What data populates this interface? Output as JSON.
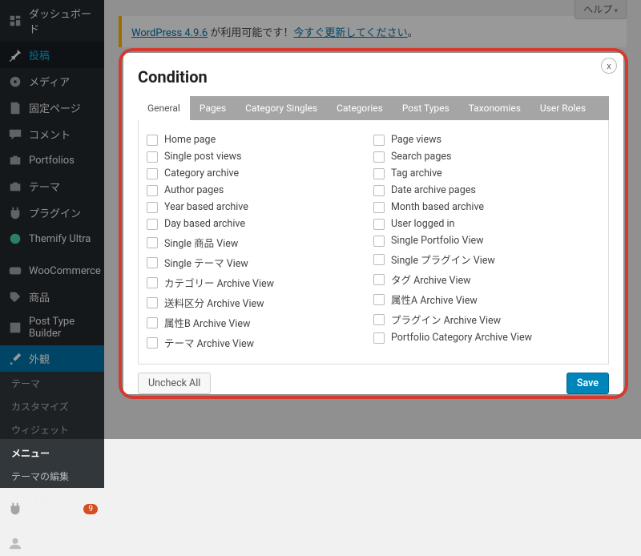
{
  "sidebar": {
    "items": [
      {
        "icon": "dashboard",
        "label": "ダッシュボード"
      },
      {
        "icon": "pin",
        "label": "投稿"
      },
      {
        "icon": "media",
        "label": "メディア"
      },
      {
        "icon": "page",
        "label": "固定ページ"
      },
      {
        "icon": "comment",
        "label": "コメント"
      },
      {
        "icon": "portfolio",
        "label": "Portfolios"
      },
      {
        "icon": "theme",
        "label": "テーマ"
      },
      {
        "icon": "plugin",
        "label": "プラグイン"
      },
      {
        "icon": "themify",
        "label": "Themify Ultra"
      },
      {
        "icon": "woo",
        "label": "WooCommerce"
      },
      {
        "icon": "product",
        "label": "商品"
      },
      {
        "icon": "ptb",
        "label": "Post Type Builder"
      },
      {
        "icon": "appearance",
        "label": "外観"
      }
    ],
    "submenu": [
      {
        "label": "テーマ"
      },
      {
        "label": "カスタマイズ"
      },
      {
        "label": "ウィジェット"
      },
      {
        "label": "メニュー"
      },
      {
        "label": "テーマの編集"
      }
    ],
    "plugins": {
      "label": "プラグイン",
      "count": "9"
    },
    "users": {
      "label": "ユーザー"
    }
  },
  "top": {
    "help": "ヘルプ",
    "notice_a1": "WordPress 4.9.6",
    "notice_mid": " が利用可能です！",
    "notice_a2": "今すぐ更新してください",
    "notice_end": "。"
  },
  "modal": {
    "title": "Condition",
    "close": "x",
    "tabs": [
      "General",
      "Pages",
      "Category Singles",
      "Categories",
      "Post Types",
      "Taxonomies",
      "User Roles"
    ],
    "left": [
      "Home page",
      "Single post views",
      "Category archive",
      "Author pages",
      "Year based archive",
      "Day based archive",
      "Single 商品 View",
      "Single テーマ View",
      "カテゴリー Archive View",
      "送料区分 Archive View",
      "属性B Archive View",
      "テーマ Archive View"
    ],
    "right": [
      "Page views",
      "Search pages",
      "Tag archive",
      "Date archive pages",
      "Month based archive",
      "User logged in",
      "Single Portfolio View",
      "Single プラグイン View",
      "タグ Archive View",
      "属性A Archive View",
      "プラグイン Archive View",
      "Portfolio Category Archive View"
    ],
    "uncheck": "Uncheck All",
    "save": "Save"
  }
}
